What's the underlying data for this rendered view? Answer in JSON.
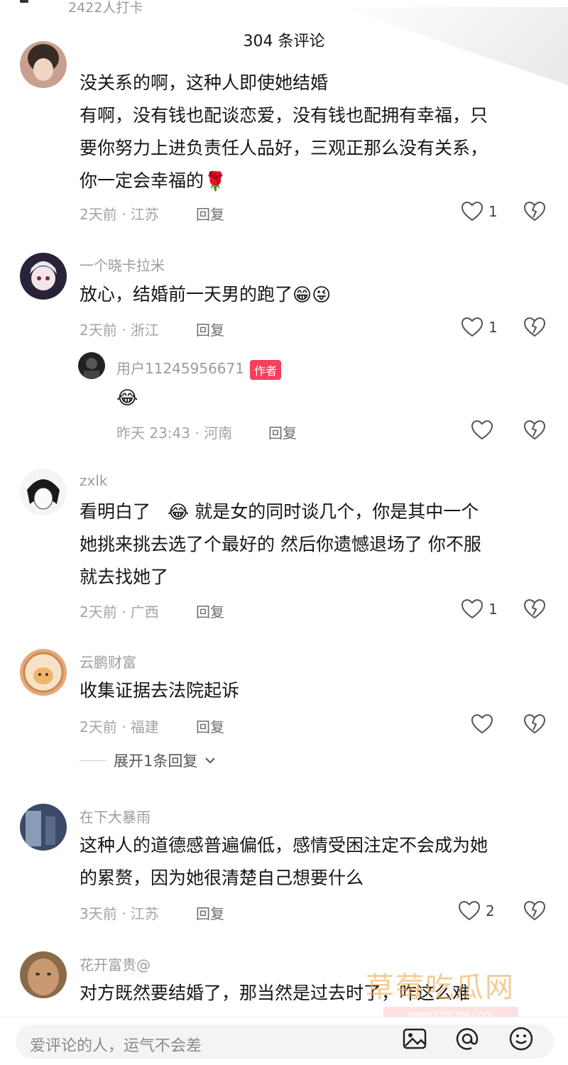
{
  "top": {
    "checkin": "2422人打卡"
  },
  "header": {
    "title": "304 条评论"
  },
  "comments": [
    {
      "username": "",
      "text": "没关系的啊，这种人即使她结婚有啊，没有钱也配谈恋爱，没有钱也配拥有幸福，只要你努力上进负责任人品好，三观正那么没有关系，你一定会幸福的",
      "lines": [
        "没关系的啊，这种人即使她结婚",
        "有啊，没有钱也配谈恋爱，没有钱也配拥有幸福，只",
        "要你努力上进负责任人品好，三观正那么没有关系，",
        "你一定会幸福的"
      ],
      "emoji": "🌹",
      "time_loc": "2天前 · 江苏",
      "reply": "回复",
      "likes": "1"
    },
    {
      "username": "一个晓卡拉米",
      "text": "放心，结婚前一天男的跑了",
      "emoji": "😁😜",
      "time_loc": "2天前 · 浙江",
      "reply": "回复",
      "likes": "1"
    },
    {
      "username": "用户11245956671",
      "author_tag": "作者",
      "emoji": "😂",
      "time_loc": "昨天 23:43 · 河南",
      "reply": "回复",
      "likes": ""
    },
    {
      "username": "zxlk",
      "lines": [
        "看明白了",
        "就是女的同时谈几个，你是其中一个",
        "她挑来挑去选了个最好的   然后你遗憾退场了   你不服",
        "就去找她了"
      ],
      "emoji": "😂",
      "time_loc": "2天前 · 广西",
      "reply": "回复",
      "likes": "1"
    },
    {
      "username": "云鹏财富",
      "text": "收集证据去法院起诉",
      "time_loc": "2天前 · 福建",
      "reply": "回复",
      "likes": "",
      "expand": "展开1条回复"
    },
    {
      "username": "在下大暴雨",
      "lines": [
        "这种人的道德感普遍偏低，感情受困注定不会成为她",
        "的累赘，因为她很清楚自己想要什么"
      ],
      "time_loc": "3天前 · 江苏",
      "reply": "回复",
      "likes": "2"
    },
    {
      "username": "花开富贵@",
      "text": "对方既然要结婚了，那当然是过去时了，咋这么难"
    }
  ],
  "bottom": {
    "placeholder": "爱评论的人，运气不会差"
  },
  "watermark": {
    "main": "草莓吃瓜网",
    "sub": "www.cmcgw.com"
  },
  "icons": [
    "heart-icon",
    "dislike-heart-icon",
    "chevron-down-icon",
    "image-icon",
    "at-icon",
    "emoji-icon"
  ]
}
